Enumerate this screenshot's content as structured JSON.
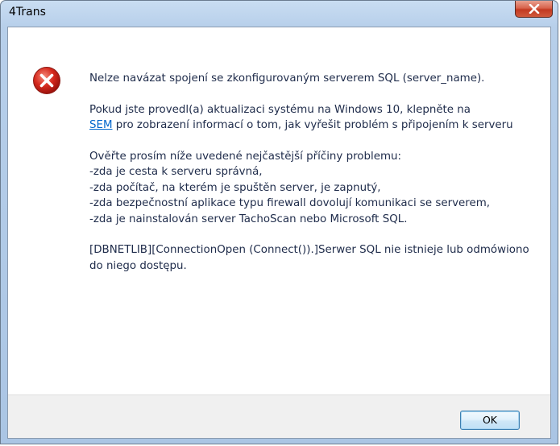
{
  "window": {
    "title": "4Trans"
  },
  "icons": {
    "close": "close-icon",
    "error": "error-icon"
  },
  "message": {
    "line1": "Nelze navázat spojení se zkonfigurovaným serverem SQL (server_name).",
    "para2_part1": "Pokud jste provedl(a) aktualizaci systému na Windows 10, klepněte na",
    "para2_link": "SEM",
    "para2_part2": " pro zobrazení informací o tom, jak vyřešit problém s připojením k serveru",
    "checks_intro": "Ověřte prosím níže uvedené nejčastější příčiny problemu:",
    "checks": [
      "-zda je cesta k serveru správná,",
      "-zda počítač, na kterém je spuštěn server, je zapnutý,",
      "-zda bezpečnostní aplikace typu firewall dovolují komunikaci se serverem,",
      "-zda je nainstalován server TachoScan nebo Microsoft SQL."
    ],
    "error_detail": "[DBNETLIB][ConnectionOpen (Connect()).]Serwer SQL nie istnieje lub odmówiono do niego dostępu."
  },
  "buttons": {
    "ok_label": "OK"
  },
  "colors": {
    "link": "#0066cc",
    "close_red": "#c23a22",
    "text": "#1e2b4a"
  }
}
